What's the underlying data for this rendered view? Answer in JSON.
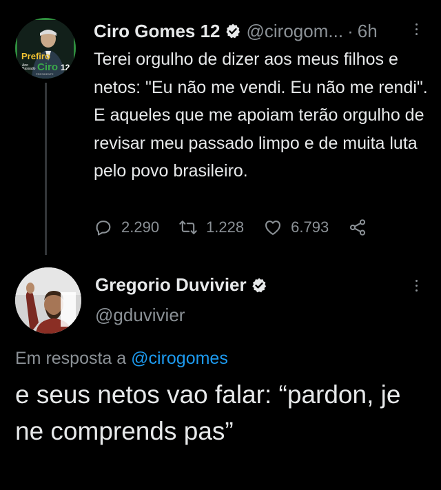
{
  "tweet1": {
    "display_name": "Ciro Gomes 12",
    "handle": "@cirogom...",
    "separator": "·",
    "time": "6h",
    "avatar": {
      "line1": "Prefiro",
      "line2": "Ciro",
      "number": "12",
      "small_left": "Ano\nPassado",
      "tagline": "PRESIDENTE"
    },
    "text": "Terei orgulho de dizer aos meus filhos e netos: \"Eu não me vendi. Eu não me rendi\". E aqueles que me apoiam terão orgulho de revisar meu passado limpo e de muita luta pelo povo brasileiro.",
    "stats": {
      "replies": "2.290",
      "retweets": "1.228",
      "likes": "6.793"
    }
  },
  "tweet2": {
    "display_name": "Gregorio Duvivier",
    "handle": "@gduvivier",
    "reply_prefix": "Em resposta a",
    "reply_mention": "@cirogomes",
    "text": "e seus netos vao falar: “pardon, je ne comprends pas”"
  },
  "colors": {
    "background": "#000000",
    "text": "#e7e9ea",
    "secondary": "#8b9196",
    "link": "#1d9bf0",
    "avatar_green": "#3aa84a"
  },
  "icons": [
    "verified-badge-icon",
    "more-options-icon",
    "reply-icon",
    "retweet-icon",
    "like-icon",
    "share-icon"
  ]
}
